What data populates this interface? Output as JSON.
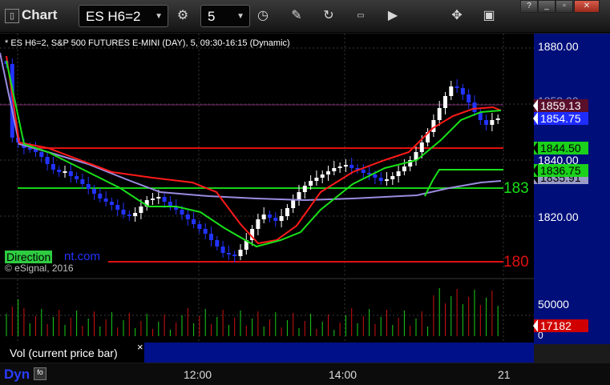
{
  "toolbar": {
    "title": "Chart",
    "symbol": "ES H6=2",
    "interval": "5"
  },
  "chart": {
    "header": "* ES H6=2, S&P 500 FUTURES E-MINI (DAY), 5, 09:30-16:15 (Dynamic)",
    "copyright": "© eSignal, 2016",
    "watermark_prefix": "Direction",
    "watermark_suffix": "nt.com",
    "level_label_green": "183",
    "level_label_red": "180",
    "price_ticks": [
      "1880.00",
      "1840.00",
      "1820.00"
    ],
    "faint_tick": "1859.00",
    "tags": [
      {
        "text": "1859.13",
        "bg": "#5a0f2a",
        "color": "#ffffff"
      },
      {
        "text": "1854.75",
        "bg": "#1e2cff",
        "color": "#ffffff"
      },
      {
        "text": "1844.50",
        "bg": "#1bd11b",
        "color": "#000000"
      },
      {
        "text": "1836.75",
        "bg": "#1bd11b",
        "color": "#000000"
      },
      {
        "text": "1835.91",
        "bg": "#9b9bc8",
        "color": "#000000"
      }
    ]
  },
  "volume": {
    "label": "Vol (current price bar)",
    "close_glyph": "×",
    "ticks": [
      "50000",
      "0"
    ],
    "current_value": "17182",
    "current_color": "#d00000"
  },
  "time_axis": {
    "badge": "Dyn",
    "labels": [
      "12:00",
      "14:00",
      "21"
    ]
  },
  "icons": {
    "window": "window-icon",
    "refresh": "refresh-icon",
    "clock": "clock-icon",
    "pencil": "pencil-icon",
    "cycle": "cycle-icon",
    "ticker": "ticker-icon",
    "play": "play-icon",
    "tools": "tools-icon",
    "monitor": "monitor-icon"
  }
}
